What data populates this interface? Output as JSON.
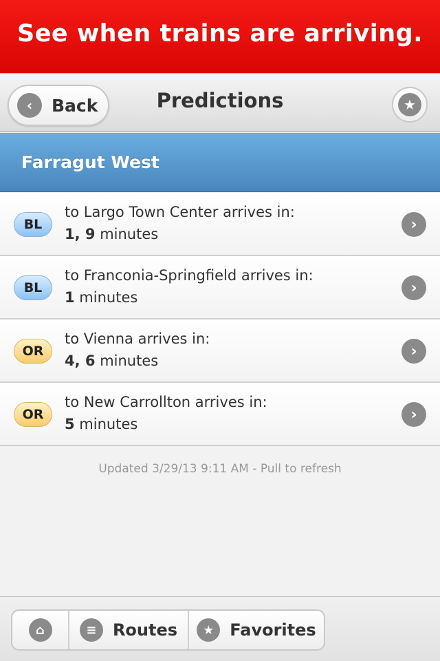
{
  "banner": {
    "text": "See when trains are arriving."
  },
  "navbar": {
    "back_label": "Back",
    "title": "Predictions",
    "back_icon": "chevron-left-icon",
    "favorite_icon": "star-icon"
  },
  "station": {
    "name": "Farragut West"
  },
  "predictions": [
    {
      "line": "BL",
      "destination": "to Largo Town Center arrives in:",
      "times": "1, 9",
      "unit": " minutes"
    },
    {
      "line": "BL",
      "destination": "to Franconia-Springfield arrives in:",
      "times": "1",
      "unit": " minutes"
    },
    {
      "line": "OR",
      "destination": "to Vienna arrives in:",
      "times": "4, 6",
      "unit": " minutes"
    },
    {
      "line": "OR",
      "destination": "to New Carrollton arrives in:",
      "times": "5",
      "unit": " minutes"
    }
  ],
  "status": {
    "updated_text": "Updated 3/29/13 9:11 AM - Pull to refresh"
  },
  "tabbar": {
    "home_icon": "home-icon",
    "routes_icon": "list-icon",
    "routes_label": "Routes",
    "favorites_icon": "star-icon",
    "favorites_label": "Favorites"
  },
  "colors": {
    "banner": "#e60d0a",
    "station_header": "#5a9ad0",
    "line_bl": "#8cc3f5",
    "line_or": "#f8cd6b"
  }
}
